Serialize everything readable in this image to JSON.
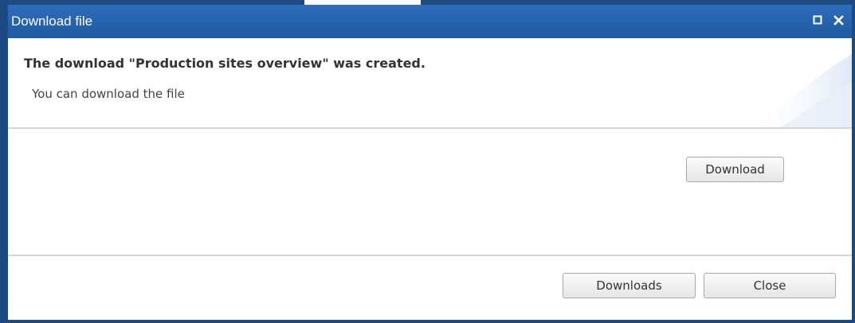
{
  "dialog": {
    "title": "Download file",
    "controls": [
      {
        "name": "maximize",
        "icon": "maximize-icon"
      },
      {
        "name": "close",
        "icon": "close-icon"
      }
    ]
  },
  "header": {
    "heading": "The download \"Production sites overview\" was created.",
    "subtext": "You can download the file"
  },
  "content": {
    "download_label": "Download"
  },
  "footer": {
    "downloads_label": "Downloads",
    "close_label": "Close"
  },
  "colors": {
    "titlebar": "#1f5aa3",
    "frame": "#1c4a82",
    "separator": "#d6d6d6"
  }
}
